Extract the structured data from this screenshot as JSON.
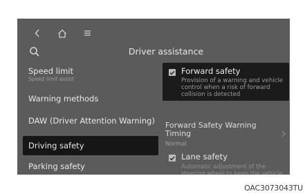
{
  "nav": {
    "back_icon": "chevron-left-icon",
    "home_icon": "home-icon",
    "menu_icon": "menu-icon",
    "search_icon": "search-icon"
  },
  "header": {
    "title": "Driver assistance"
  },
  "menu": {
    "speed_limit": {
      "label": "Speed limit",
      "sub": "Speed limit assist"
    },
    "warning_methods": {
      "label": "Warning methods"
    },
    "daw": {
      "label": "DAW (Driver Attention Warning)"
    },
    "driving_safety": {
      "label": "Driving safety",
      "selected": true
    },
    "parking_safety": {
      "label": "Parking safety"
    }
  },
  "content": {
    "forward_safety": {
      "label": "Forward safety",
      "checked": true,
      "description": "Provision of a warning and vehicle control when a risk of forward collision is detected"
    },
    "forward_safety_warning_timing": {
      "label": "Forward Safety Warning Timing",
      "value": "Normal"
    },
    "lane_safety": {
      "label": "Lane safety",
      "checked": true,
      "description": "Automatic adjustment of the steering wheel to keep the vehicle within the boundaries of the lane."
    }
  },
  "caption": "OAC3073043TU",
  "colors": {
    "screen_bg": "#5b5b5b",
    "selected_bg": "#161616",
    "text": "#e8e8e8",
    "subtext": "#9a9a9a"
  }
}
